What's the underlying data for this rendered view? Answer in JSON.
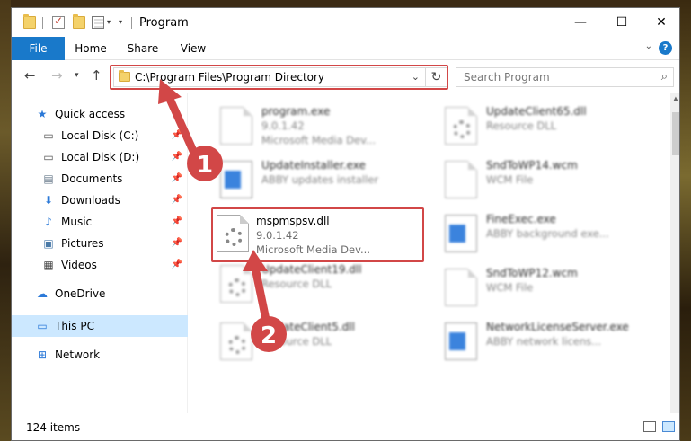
{
  "window": {
    "title": "Program",
    "controls": {
      "minimize": "—",
      "maximize": "☐",
      "close": "✕"
    }
  },
  "ribbon": {
    "tabs": [
      "File",
      "Home",
      "Share",
      "View"
    ],
    "help": "?"
  },
  "nav": {
    "address": "C:\\Program Files\\Program Directory",
    "search_placeholder": "Search Program"
  },
  "sidebar": {
    "items": [
      {
        "label": "Quick access",
        "icon": "star-icon",
        "pinned": false
      },
      {
        "label": "Local Disk (C:)",
        "icon": "drive-icon",
        "pinned": true
      },
      {
        "label": "Local Disk (D:)",
        "icon": "drive-icon",
        "pinned": true
      },
      {
        "label": "Documents",
        "icon": "documents-icon",
        "pinned": true
      },
      {
        "label": "Downloads",
        "icon": "download-icon",
        "pinned": true
      },
      {
        "label": "Music",
        "icon": "music-icon",
        "pinned": true
      },
      {
        "label": "Pictures",
        "icon": "pictures-icon",
        "pinned": true
      },
      {
        "label": "Videos",
        "icon": "videos-icon",
        "pinned": true
      },
      {
        "label": "OneDrive",
        "icon": "cloud-icon",
        "pinned": false
      },
      {
        "label": "This PC",
        "icon": "pc-icon",
        "pinned": false,
        "selected": true
      },
      {
        "label": "Network",
        "icon": "network-icon",
        "pinned": false
      }
    ]
  },
  "files": {
    "left": [
      {
        "name": "program.exe",
        "line1": "9.0.1.42",
        "line2": "Microsoft Media Dev..."
      },
      {
        "name": "UpdateInstaller.exe",
        "line1": "ABBY updates installer",
        "line2": ""
      },
      {
        "name": "mspmspsv.dll",
        "line1": "9.0.1.42",
        "line2": "Microsoft Media Dev...",
        "highlighted": true
      },
      {
        "name": "UpdateClient19.dll",
        "line1": "Resource DLL",
        "line2": ""
      },
      {
        "name": "UpdateClient5.dll",
        "line1": "Resource DLL",
        "line2": ""
      }
    ],
    "right": [
      {
        "name": "UpdateClient65.dll",
        "line1": "Resource DLL",
        "line2": ""
      },
      {
        "name": "SndToWP14.wcm",
        "line1": "WCM File",
        "line2": ""
      },
      {
        "name": "FineExec.exe",
        "line1": "ABBY background exe...",
        "line2": ""
      },
      {
        "name": "SndToWP12.wcm",
        "line1": "WCM File",
        "line2": ""
      },
      {
        "name": "NetworkLicenseServer.exe",
        "line1": "ABBY network licens...",
        "line2": ""
      }
    ]
  },
  "status": {
    "item_count": "124 items"
  },
  "annotations": {
    "step1": "1",
    "step2": "2",
    "color": "#d24747"
  }
}
